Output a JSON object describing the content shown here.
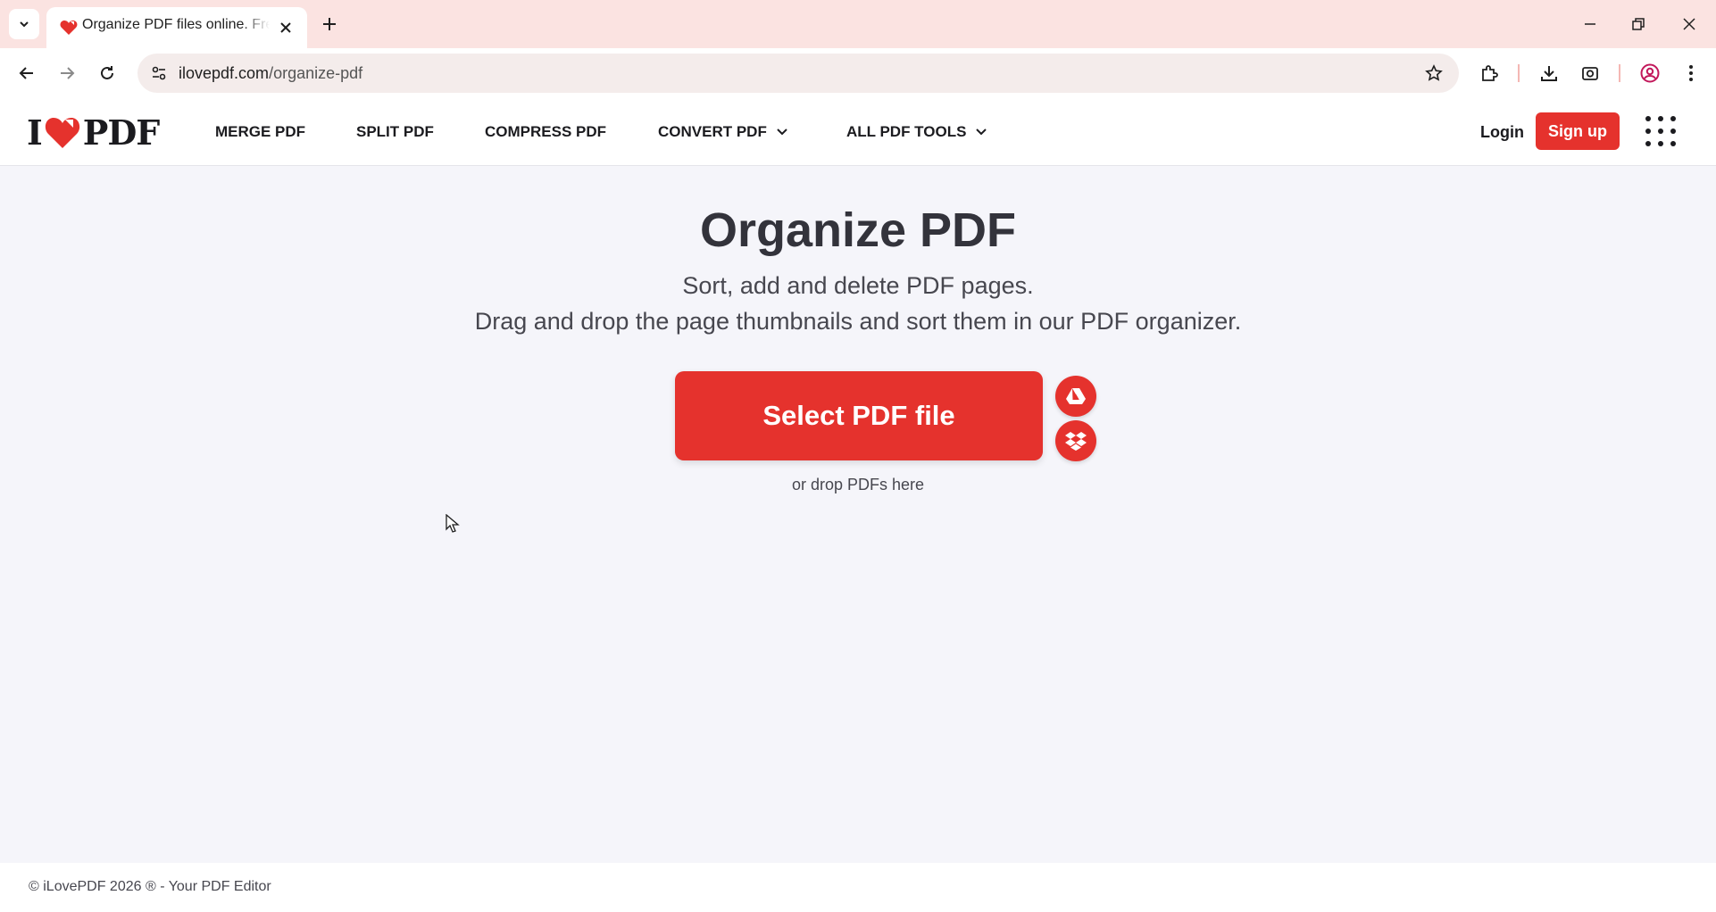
{
  "browser": {
    "tab_title": "Organize PDF files online. Free service",
    "url_domain": "ilovepdf.com",
    "url_path": "/organize-pdf",
    "accent": "#fbe3e1"
  },
  "header": {
    "logo_left": "I",
    "logo_right": "PDF",
    "nav": [
      "MERGE PDF",
      "SPLIT PDF",
      "COMPRESS PDF",
      "CONVERT PDF",
      "ALL PDF TOOLS"
    ],
    "login": "Login",
    "signup": "Sign up"
  },
  "main": {
    "title": "Organize PDF",
    "subtitle_1": "Sort, add and delete PDF pages.",
    "subtitle_2": "Drag and drop the page thumbnails and sort them in our PDF organizer.",
    "select_button": "Select PDF file",
    "drop_hint": "or drop PDFs here",
    "cloud_icons": [
      "google-drive-icon",
      "dropbox-icon"
    ]
  },
  "footer": {
    "text": "© iLovePDF 2026 ® - Your PDF Editor"
  },
  "colors": {
    "brand_red": "#e5322d",
    "text_dark": "#33333b",
    "page_bg": "#f5f5fa"
  }
}
